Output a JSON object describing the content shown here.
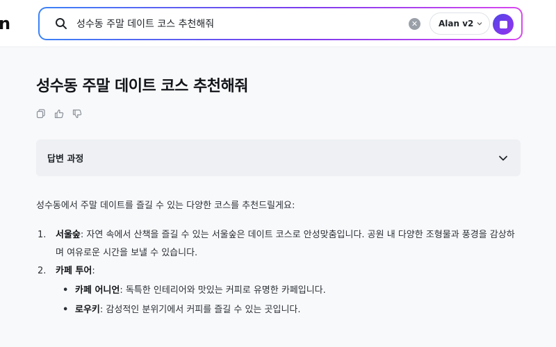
{
  "header": {
    "logo_fragment": "n",
    "search": {
      "value": "성수동 주말 데이트 코스 추천해줘",
      "clear_symbol": "✕"
    },
    "model_selector": {
      "label": "Alan v2"
    }
  },
  "main": {
    "question_title": "성수동 주말 데이트 코스 추천해줘",
    "process_panel": {
      "label": "답변 과정"
    },
    "answer": {
      "intro": "성수동에서 주말 데이트를 즐길 수 있는 다양한 코스를 추천드릴게요:",
      "items": [
        {
          "number": "1.",
          "title": "서울숲",
          "separator": ":",
          "text": " 자연 속에서 산책을 즐길 수 있는 서울숲은 데이트 코스로 안성맞춤입니다. 공원 내 다양한 조형물과 풍경을 감상하며 여유로운 시간을 보낼 수 있습니다."
        },
        {
          "number": "2.",
          "title": "카페 투어",
          "separator": ":",
          "subitems": [
            {
              "bullet": "•",
              "title": "카페 어니언",
              "separator": ":",
              "text": " 독특한 인테리어와 맛있는 커피로 유명한 카페입니다."
            },
            {
              "bullet": "•",
              "title": "로우키",
              "separator": ":",
              "text": " 감성적인 분위기에서 커피를 즐길 수 있는 곳입니다."
            }
          ]
        }
      ]
    }
  },
  "colors": {
    "search_gradient_start": "#3b82f6",
    "search_gradient_end": "#d946ef",
    "stop_button": "#6d28d9",
    "process_panel_bg": "#eef0f3",
    "page_bg": "#f8f9fa"
  },
  "icons": {
    "search": "search-icon",
    "clear": "clear-icon",
    "model_chevron": "chevron-down-icon",
    "stop": "stop-icon",
    "copy": "copy-icon",
    "like": "thumbs-up-icon",
    "dislike": "thumbs-down-icon",
    "expand": "chevron-down-icon"
  }
}
